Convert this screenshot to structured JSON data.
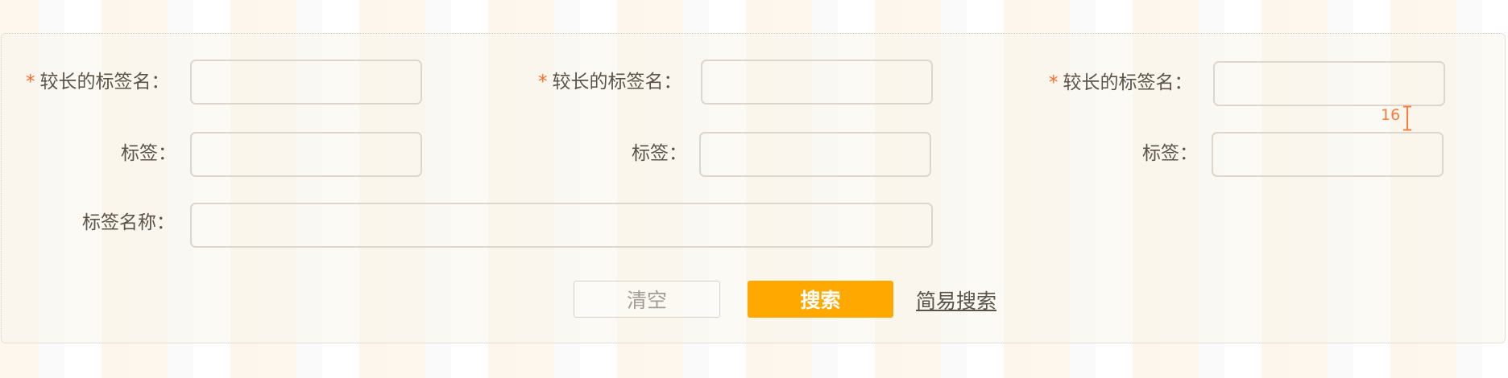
{
  "form": {
    "row1": [
      {
        "label": "较长的标签名",
        "colon": "：",
        "required_mark": "*",
        "value": ""
      },
      {
        "label": "较长的标签名",
        "colon": "：",
        "required_mark": "*",
        "value": ""
      },
      {
        "label": "较长的标签名",
        "colon": "：",
        "required_mark": "*",
        "value": ""
      }
    ],
    "row2": [
      {
        "label": "标签",
        "colon": "：",
        "value": ""
      },
      {
        "label": "标签",
        "colon": "：",
        "value": ""
      },
      {
        "label": "标签",
        "colon": "：",
        "value": ""
      }
    ],
    "row3": {
      "label": "标签名称",
      "colon": "：",
      "value": ""
    }
  },
  "actions": {
    "clear_label": "清空",
    "search_label": "搜索",
    "simple_search_label": "简易搜索"
  },
  "annotation": {
    "spacing_value": "16"
  },
  "colors": {
    "accent": "#ffa800",
    "required": "#ff6a2a",
    "annotation": "#ff7a3e"
  }
}
